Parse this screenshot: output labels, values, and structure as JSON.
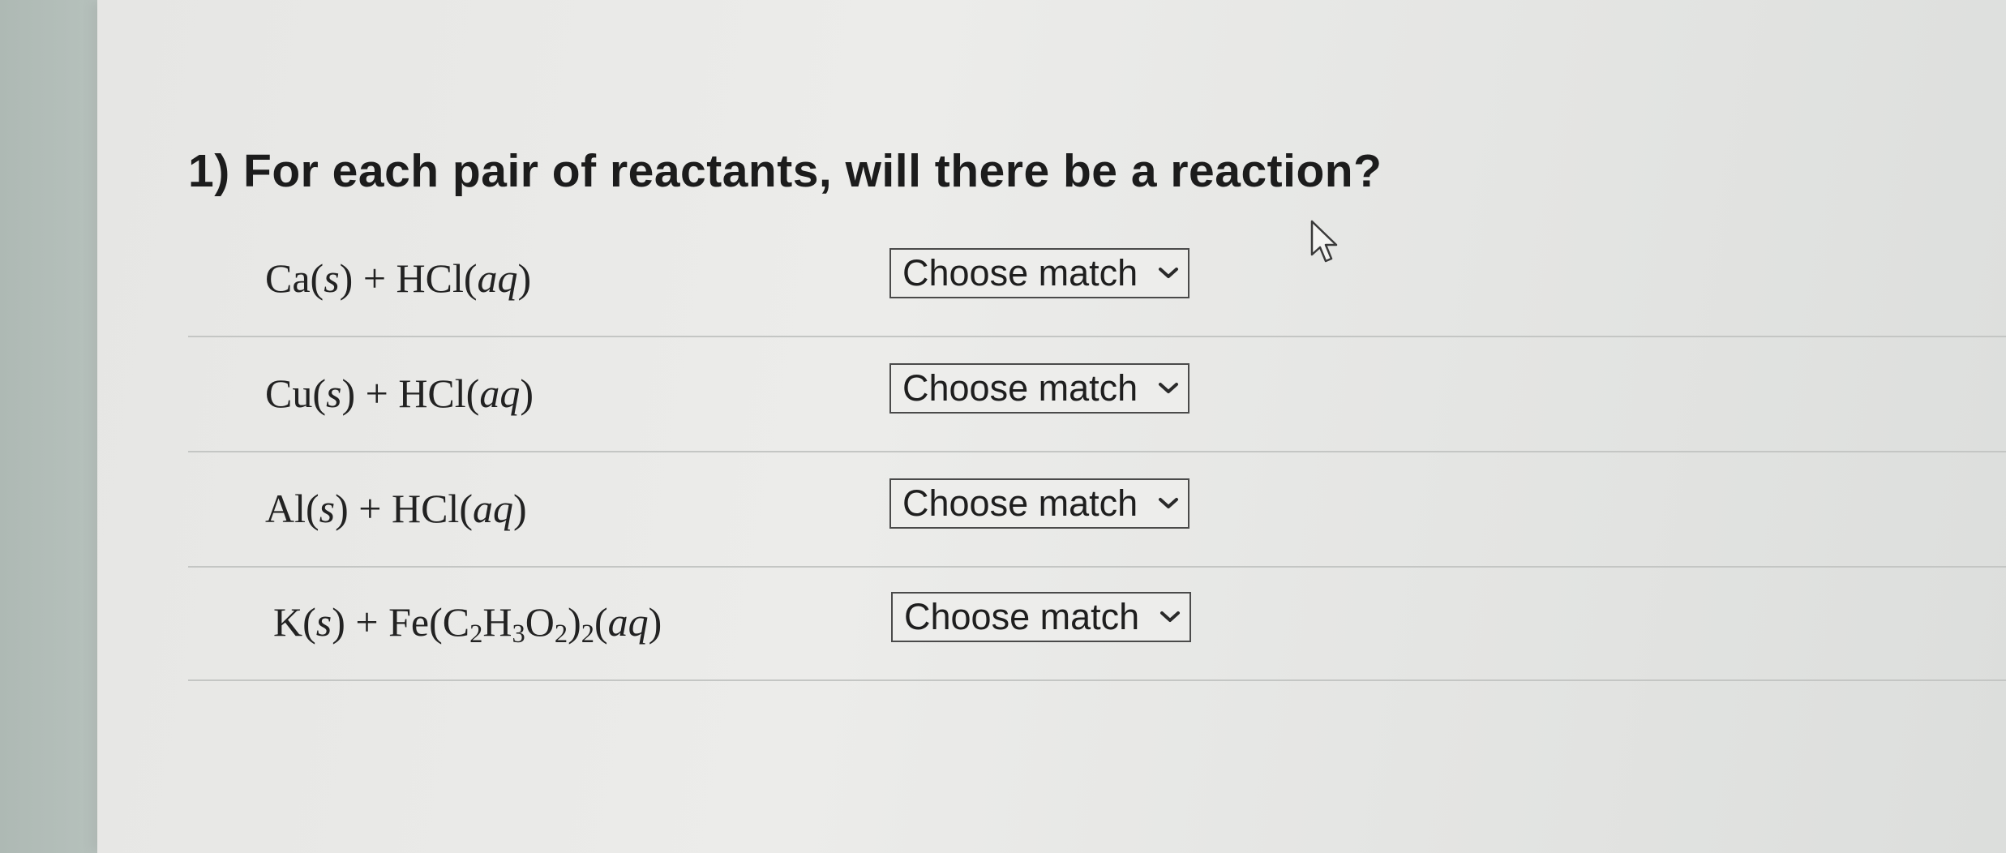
{
  "question": {
    "title": "1) For each pair of reactants, will there be a reaction?"
  },
  "rows": [
    {
      "formula_parts": [
        "Ca(",
        "s",
        ") + HCl(",
        "aq",
        ")"
      ],
      "select_label": "Choose match"
    },
    {
      "formula_parts": [
        "Cu(",
        "s",
        ") + HCl(",
        "aq",
        ")"
      ],
      "select_label": "Choose match"
    },
    {
      "formula_parts": [
        "Al(",
        "s",
        ") + HCl(",
        "aq",
        ")"
      ],
      "select_label": "Choose match"
    },
    {
      "formula_parts": [
        "K(",
        "s",
        ") + Fe(C",
        "2",
        "H",
        "3",
        "O",
        "2",
        ")",
        "2",
        "(",
        "aq",
        ")"
      ],
      "select_label": "Choose match"
    }
  ],
  "icons": {
    "dropdown": "chevron-down-icon",
    "cursor": "mouse-pointer-icon"
  },
  "colors": {
    "text": "#1c1c1c",
    "select_border": "#4a4a4a",
    "divider": "#c4c6c4"
  }
}
